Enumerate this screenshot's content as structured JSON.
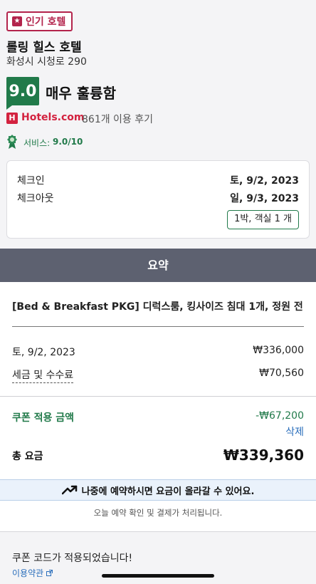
{
  "badge": {
    "label": "인기 호텔",
    "icon": "star-badge-icon"
  },
  "hotel": {
    "name": "롤링 힐스 호텔",
    "address": "화성시 시청로 290"
  },
  "rating": {
    "score": "9.0",
    "label": "매우 훌륭함",
    "color": "#217a4a"
  },
  "reviews": {
    "brand": "Hotels.com",
    "count_text": "861개 이용 후기",
    "brand_color": "#d3223f"
  },
  "service": {
    "label": "서비스:",
    "value": "9.0/10"
  },
  "stay": {
    "checkin_label": "체크인",
    "checkin_value": "토, 9/2, 2023",
    "checkout_label": "체크아웃",
    "checkout_value": "일, 9/3, 2023",
    "summary": "1박, 객실 1 개"
  },
  "summary_header": "요약",
  "room": {
    "name": "[Bed & Breakfast PKG] 디럭스룸, 킹사이즈 침대 1개, 정원 전..."
  },
  "prices": {
    "night_date": "토, 9/2, 2023",
    "night_price": "₩336,000",
    "tax_label": "세금 및 수수료",
    "tax_price": "₩70,560",
    "coupon_label": "쿠폰 적용 금액",
    "coupon_amount": "-₩67,200",
    "coupon_delete": "삭제",
    "total_label": "총 요금",
    "total_price": "₩339,360"
  },
  "notice": {
    "text": "나중에 예약하시면 요금이 올라갈 수 있어요.",
    "icon": "trending-up-icon"
  },
  "confirm_note": "오늘 예약 확인 및 결제가 처리됩니다.",
  "footer": {
    "coupon_applied": "쿠폰 코드가 적용되었습니다!",
    "terms": "이용약관"
  },
  "colors": {
    "accent_green": "#217a4a",
    "link_blue": "#2a6ebb",
    "brand_red": "#b3244c",
    "header_gray": "#5d6170"
  }
}
